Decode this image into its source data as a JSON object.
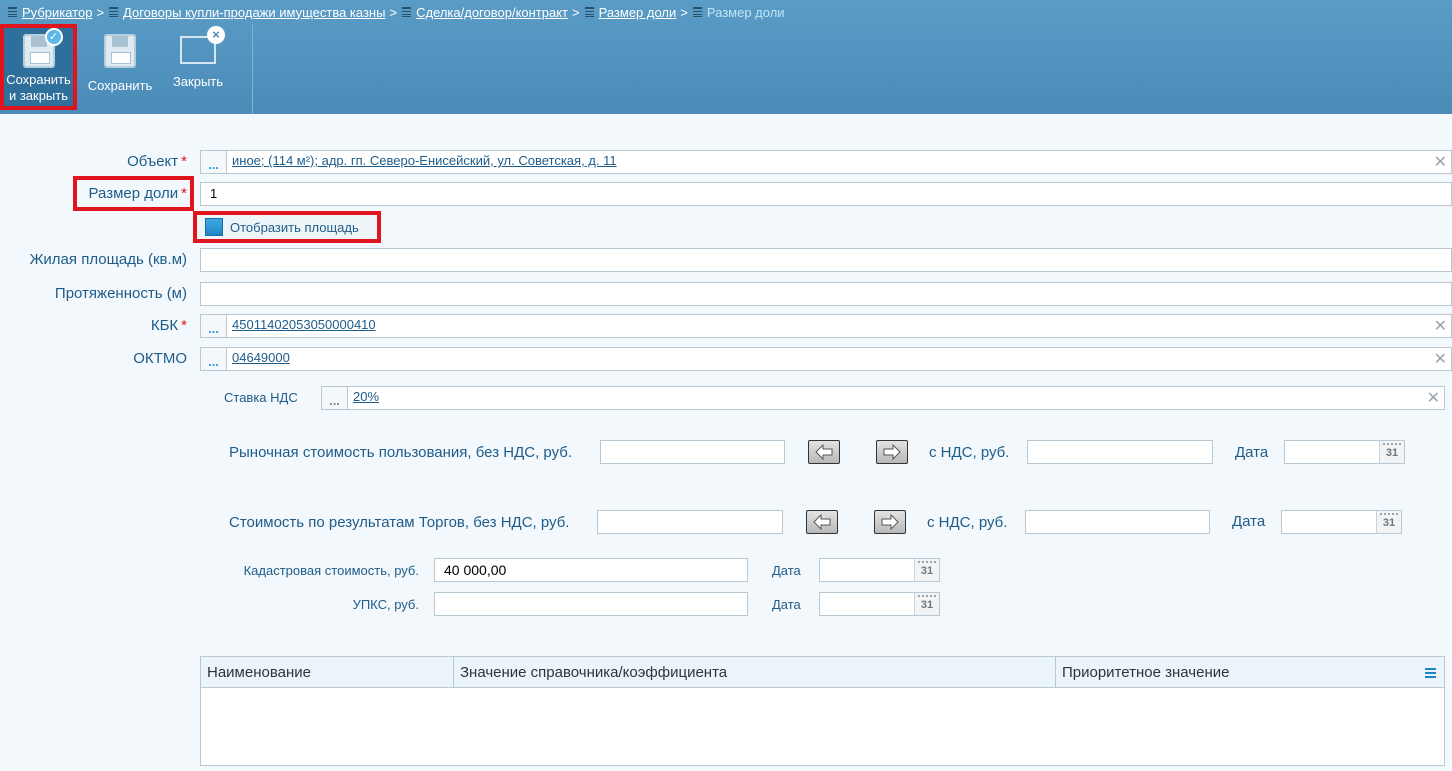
{
  "breadcrumb": [
    {
      "label": "Рубрикатор",
      "link": true
    },
    {
      "label": "Договоры купли-продажи имущества казны",
      "link": true
    },
    {
      "label": "Сделка/договор/контракт",
      "link": true
    },
    {
      "label": "Размер доли",
      "link": true
    },
    {
      "label": "Размер доли",
      "link": false
    }
  ],
  "breadcrumb_sep": ">",
  "toolbar": {
    "save_close_line1": "Сохранить",
    "save_close_line2": "и закрыть",
    "save": "Сохранить",
    "close": "Закрыть"
  },
  "form": {
    "object": {
      "label": "Объект",
      "value": "иное; (114 м²); адр. гп. Северо-Енисейский, ул. Советская, д. 11"
    },
    "share_size": {
      "label": "Размер доли",
      "value": "1"
    },
    "show_area": {
      "label": "Отобразить площадь"
    },
    "living_area": {
      "label": "Жилая площадь (кв.м)",
      "value": ""
    },
    "length": {
      "label": "Протяженность (м)",
      "value": ""
    },
    "kbk": {
      "label": "КБК",
      "value": "45011402053050000410"
    },
    "oktmo": {
      "label": "ОКТМО",
      "value": "04649000"
    },
    "vat_rate": {
      "label": "Ставка НДС",
      "value": "20%"
    },
    "market_cost": {
      "label": "Рыночная стоимость пользования, без НДС, руб.",
      "value": "",
      "vat_label": "с НДС, руб.",
      "vat_value": "",
      "date_label": "Дата",
      "date_value": ""
    },
    "auction_cost": {
      "label": "Стоимость по результатам Торгов, без НДС, руб.",
      "value": "",
      "vat_label": "с НДС, руб.",
      "vat_value": "",
      "date_label": "Дата",
      "date_value": ""
    },
    "cadastral_cost": {
      "label": "Кадастровая стоимость, руб.",
      "value": "40 000,00",
      "date_label": "Дата",
      "date_value": ""
    },
    "upks": {
      "label": "УПКС, руб.",
      "value": "",
      "date_label": "Дата",
      "date_value": ""
    }
  },
  "calendar_glyph": "31",
  "dots_glyph": "...",
  "clear_glyph": "✕",
  "table": {
    "columns": [
      "Наименование",
      "Значение справочника/коэффициента",
      "Приоритетное значение"
    ]
  },
  "colors": {
    "header": "#4a8bb8",
    "label": "#1f5c8a",
    "highlight": "#e0141d"
  }
}
